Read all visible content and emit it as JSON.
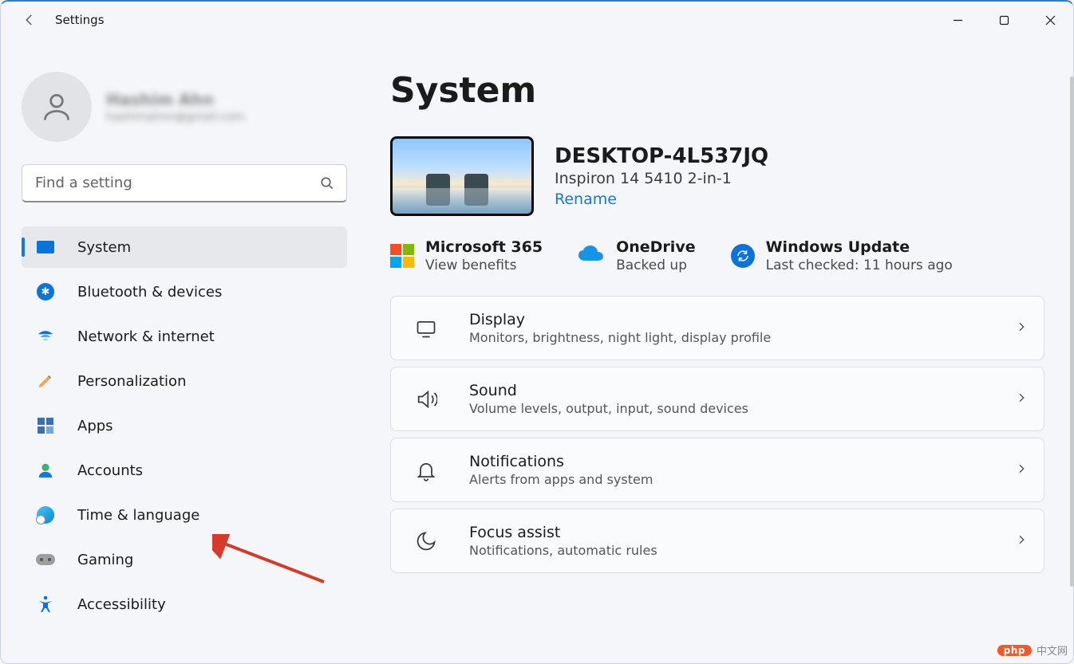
{
  "app_title": "Settings",
  "user": {
    "name": "Hashim Ahn",
    "email": "hashimahnn@gmail.com"
  },
  "search": {
    "placeholder": "Find a setting"
  },
  "nav": [
    {
      "key": "system",
      "label": "System",
      "active": true
    },
    {
      "key": "bluetooth",
      "label": "Bluetooth & devices",
      "active": false
    },
    {
      "key": "network",
      "label": "Network & internet",
      "active": false
    },
    {
      "key": "personalization",
      "label": "Personalization",
      "active": false
    },
    {
      "key": "apps",
      "label": "Apps",
      "active": false
    },
    {
      "key": "accounts",
      "label": "Accounts",
      "active": false
    },
    {
      "key": "time",
      "label": "Time & language",
      "active": false
    },
    {
      "key": "gaming",
      "label": "Gaming",
      "active": false
    },
    {
      "key": "accessibility",
      "label": "Accessibility",
      "active": false
    }
  ],
  "page_title": "System",
  "device": {
    "name": "DESKTOP-4L537JQ",
    "model": "Inspiron 14 5410 2-in-1",
    "rename_label": "Rename"
  },
  "status": {
    "ms365": {
      "title": "Microsoft 365",
      "sub": "View benefits"
    },
    "onedrive": {
      "title": "OneDrive",
      "sub": "Backed up"
    },
    "wu": {
      "title": "Windows Update",
      "sub": "Last checked: 11 hours ago"
    }
  },
  "cards": [
    {
      "key": "display",
      "title": "Display",
      "desc": "Monitors, brightness, night light, display profile"
    },
    {
      "key": "sound",
      "title": "Sound",
      "desc": "Volume levels, output, input, sound devices"
    },
    {
      "key": "notifications",
      "title": "Notifications",
      "desc": "Alerts from apps and system"
    },
    {
      "key": "focus",
      "title": "Focus assist",
      "desc": "Notifications, automatic rules"
    }
  ],
  "watermark": {
    "badge": "php",
    "text": "中文网"
  }
}
